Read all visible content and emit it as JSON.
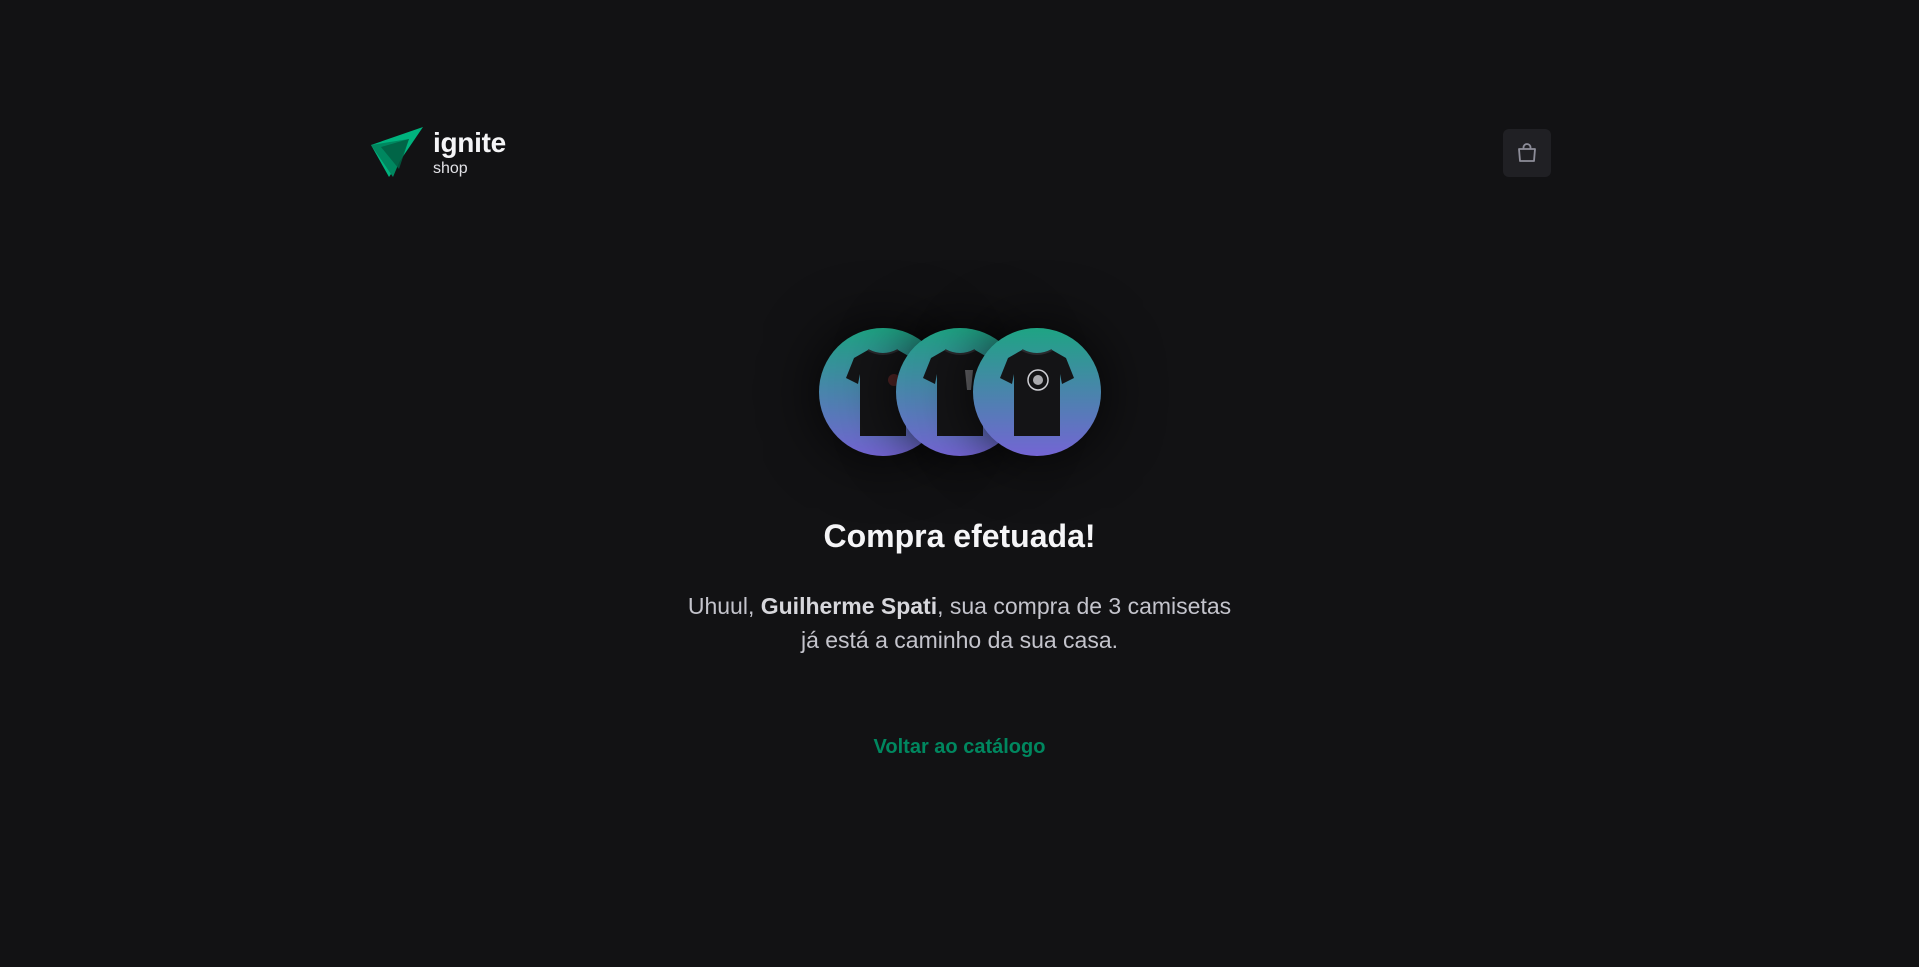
{
  "brand": {
    "title": "ignite",
    "subtitle": "shop",
    "colors": {
      "accent": "#00875f",
      "background": "#121214",
      "gradient_start": "#1ea483",
      "gradient_end": "#7465d4"
    }
  },
  "header": {
    "cart_icon": "shopping-bag-icon"
  },
  "success": {
    "title": "Compra efetuada!",
    "message_prefix": "Uhuul, ",
    "customer_name": "Guilherme Spati",
    "message_middle": ", sua compra de 3 camisetas",
    "message_line2": "já está a caminho da sua casa.",
    "products": [
      {
        "icon": "tshirt-icon"
      },
      {
        "icon": "tshirt-icon"
      },
      {
        "icon": "tshirt-icon"
      }
    ],
    "back_link": "Voltar ao catálogo"
  }
}
